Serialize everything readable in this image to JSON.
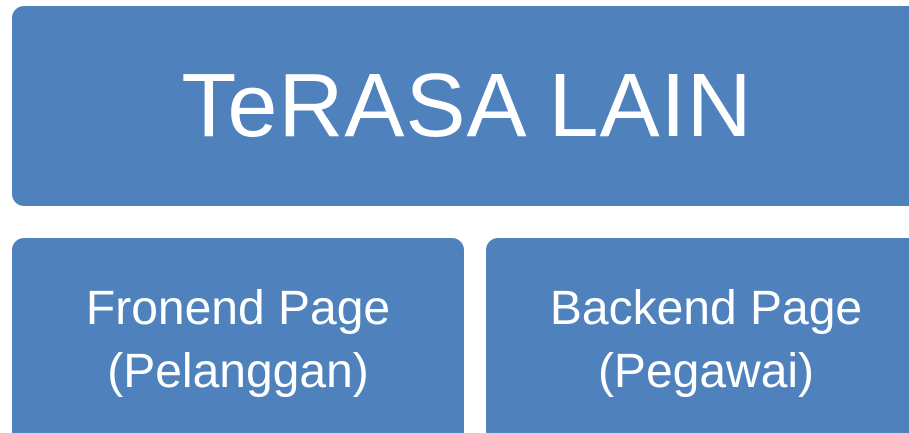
{
  "diagram": {
    "colors": {
      "box_fill": "#4f81bd",
      "text": "#ffffff",
      "background": "#ffffff"
    },
    "root": {
      "label": "TeRASA LAIN"
    },
    "children": [
      {
        "line1": "Fronend Page",
        "line2": "(Pelanggan)"
      },
      {
        "line1": "Backend Page",
        "line2": "(Pegawai)"
      }
    ]
  }
}
